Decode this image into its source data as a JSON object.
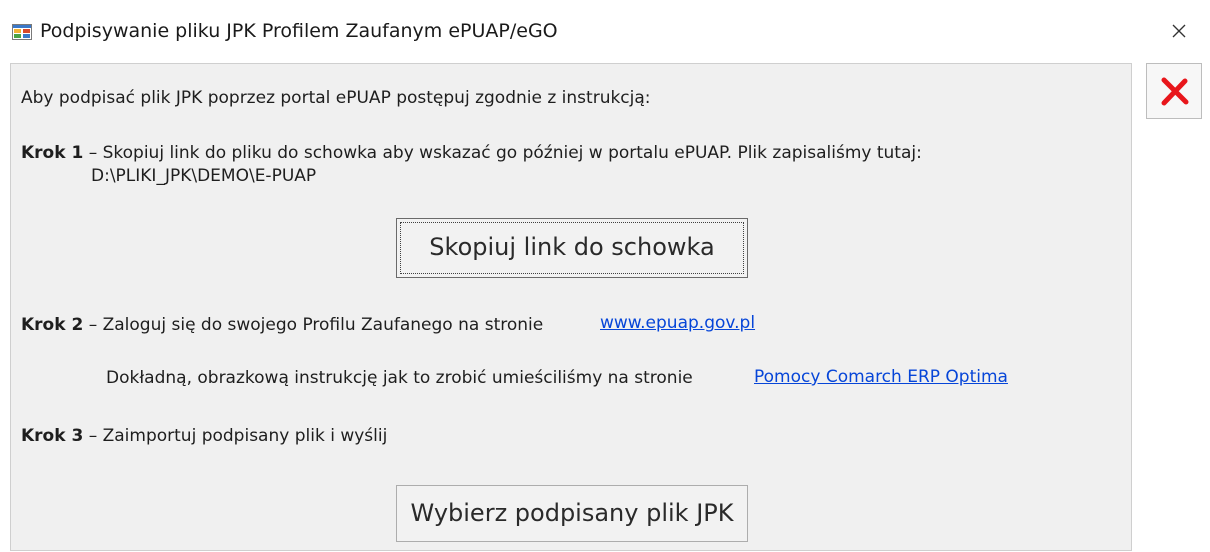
{
  "window": {
    "title": "Podpisywanie pliku JPK Profilem Zaufanym ePUAP/eGO",
    "close_icon": "close-icon"
  },
  "content": {
    "intro": "Aby podpisać plik JPK poprzez portal ePUAP postępuj zgodnie z instrukcją:",
    "step1": {
      "label": "Krok 1",
      "text": " – Skopiuj link do pliku do schowka aby wskazać go później w portalu ePUAP. Plik zapisaliśmy tutaj:",
      "path": "D:\\PLIKI_JPK\\DEMO\\E-PUAP",
      "button": "Skopiuj link do schowka"
    },
    "step2": {
      "label": "Krok 2",
      "text": " – Zaloguj się do swojego Profilu Zaufanego na stronie",
      "link": "www.epuap.gov.pl",
      "detail_text": "Dokładną, obrazkową instrukcję jak to zrobić umieściliśmy na stronie",
      "detail_link": "Pomocy Comarch ERP Optima"
    },
    "step3": {
      "label": "Krok 3",
      "text": " – Zaimportuj podpisany plik i wyślij",
      "button": "Wybierz podpisany plik JPK"
    }
  },
  "sidebar": {
    "cancel_icon": "red-x-cancel-icon",
    "cancel_color": "#e8161b"
  }
}
